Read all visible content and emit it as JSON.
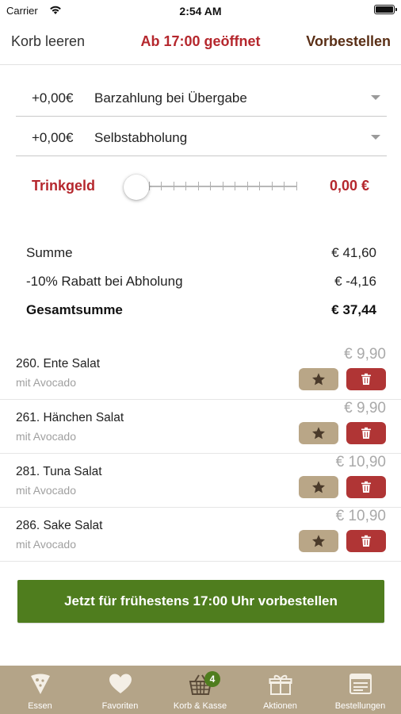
{
  "status_bar": {
    "carrier": "Carrier",
    "time": "2:54 AM"
  },
  "nav": {
    "left_label": "Korb leeren",
    "title": "Ab 17:00 geöffnet",
    "right_label": "Vorbestellen"
  },
  "payment": {
    "price": "+0,00€",
    "label": "Barzahlung bei Übergabe"
  },
  "delivery": {
    "price": "+0,00€",
    "label": "Selbstabholung"
  },
  "tip": {
    "label": "Trinkgeld",
    "value": "0,00 €",
    "slider_level": 0
  },
  "summary": {
    "subtotal_label": "Summe",
    "subtotal_value": "€ 41,60",
    "discount_label": "-10% Rabatt bei Abholung",
    "discount_value": "€ -4,16",
    "total_label": "Gesamtsumme",
    "total_value": "€ 37,44"
  },
  "items": [
    {
      "name": "260. Ente Salat",
      "sub": "mit Avocado",
      "price": "€ 9,90"
    },
    {
      "name": "261. Hänchen Salat",
      "sub": "mit Avocado",
      "price": "€ 9,90"
    },
    {
      "name": "281. Tuna Salat",
      "sub": "mit Avocado",
      "price": "€ 10,90"
    },
    {
      "name": "286. Sake Salat",
      "sub": "mit Avocado",
      "price": "€ 10,90"
    }
  ],
  "cta_label": "Jetzt für frühestens 17:00 Uhr vorbestellen",
  "tabbar": {
    "tabs": [
      {
        "label": "Essen",
        "icon": "pizza-slice-icon"
      },
      {
        "label": "Favoriten",
        "icon": "heart-icon"
      },
      {
        "label": "Korb & Kasse",
        "icon": "basket-icon",
        "badge": "4"
      },
      {
        "label": "Aktionen",
        "icon": "gift-icon"
      },
      {
        "label": "Bestellungen",
        "icon": "receipt-icon"
      }
    ]
  },
  "colors": {
    "accent_red": "#b5272d",
    "dark_brown": "#5a2f16",
    "cta_green": "#4f7d1e",
    "tabbar_tan": "#b4a488",
    "fav_button": "#b9a687",
    "delete_button": "#b03535"
  }
}
